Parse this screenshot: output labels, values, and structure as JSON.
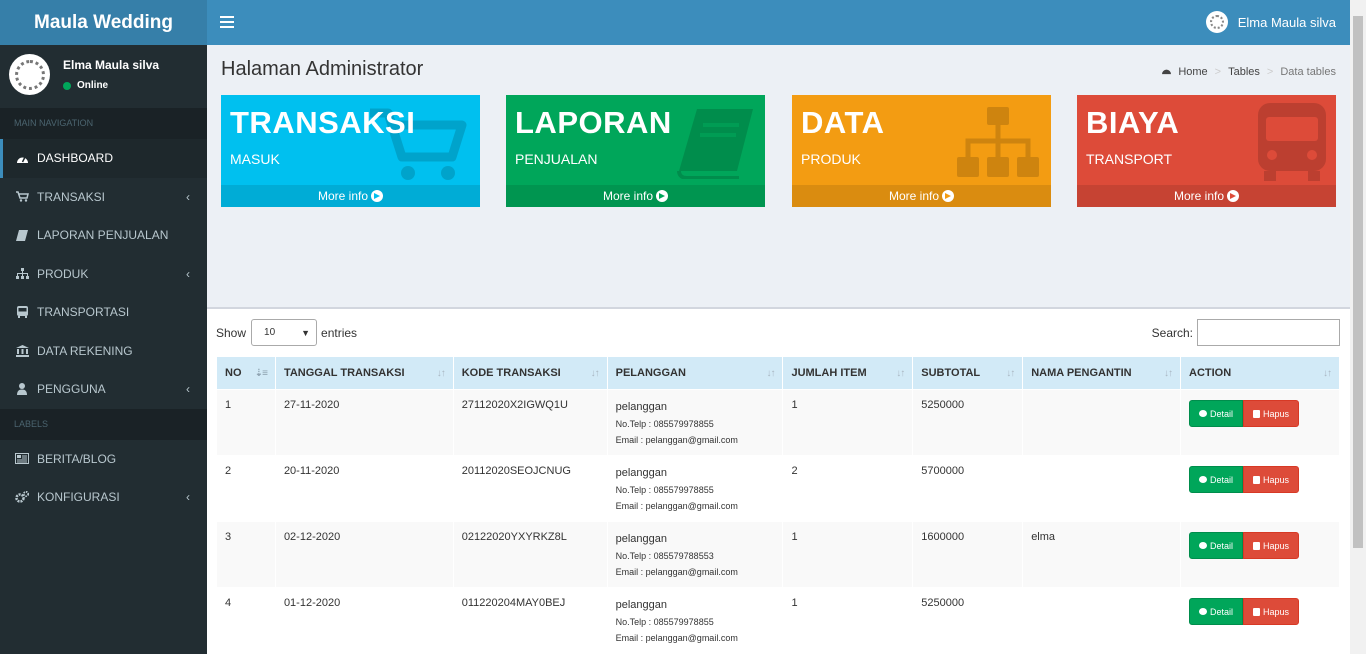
{
  "app": {
    "brand": "Maula Wedding",
    "user_name": "Elma Maula silva"
  },
  "sidebar": {
    "user": {
      "name": "Elma Maula silva",
      "status": "Online"
    },
    "main_nav_header": "MAIN NAVIGATION",
    "items": [
      {
        "label": "DASHBOARD",
        "icon": "dashboard-icon"
      },
      {
        "label": "TRANSAKSI",
        "icon": "cart-icon"
      },
      {
        "label": "LAPORAN PENJUALAN",
        "icon": "book-icon"
      },
      {
        "label": "PRODUK",
        "icon": "sitemap-icon"
      },
      {
        "label": "TRANSPORTASI",
        "icon": "bus-icon"
      },
      {
        "label": "DATA REKENING",
        "icon": "bank-icon"
      },
      {
        "label": "PENGGUNA",
        "icon": "user-icon"
      }
    ],
    "labels_header": "LABELS",
    "label_items": [
      {
        "label": "BERITA/BLOG",
        "icon": "newspaper-icon"
      },
      {
        "label": "KONFIGURASI",
        "icon": "cogs-icon"
      }
    ]
  },
  "page": {
    "title": "Halaman Administrator",
    "breadcrumb": [
      "Home",
      "Tables",
      "Data tables"
    ]
  },
  "boxes": [
    {
      "title": "TRANSAKSI",
      "subtitle": "MASUK",
      "footer": "More info",
      "color": "#00c0ef",
      "icon": "cart-icon"
    },
    {
      "title": "LAPORAN",
      "subtitle": "PENJUALAN",
      "footer": "More info",
      "color": "#00a65a",
      "icon": "book-icon"
    },
    {
      "title": "DATA",
      "subtitle": "PRODUK",
      "footer": "More info",
      "color": "#f39c12",
      "icon": "sitemap-icon"
    },
    {
      "title": "BIAYA",
      "subtitle": "TRANSPORT",
      "footer": "More info",
      "color": "#dd4b39",
      "icon": "bus-icon"
    }
  ],
  "table": {
    "show_label": "Show",
    "entries_value": "10",
    "entries_label": "entries",
    "search_label": "Search:",
    "headers": [
      "NO",
      "TANGGAL TRANSAKSI",
      "KODE TRANSAKSI",
      "PELANGGAN",
      "JUMLAH ITEM",
      "SUBTOTAL",
      "NAMA PENGANTIN",
      "ACTION"
    ],
    "detail_label": "Detail",
    "hapus_label": "Hapus",
    "rows": [
      {
        "no": "1",
        "tanggal": "27-11-2020",
        "kode": "27112020X2IGWQ1U",
        "pelanggan": "pelanggan",
        "telp": "No.Telp : 085579978855",
        "email": "Email : pelanggan@gmail.com",
        "jumlah": "1",
        "subtotal": "5250000",
        "pengantin": ""
      },
      {
        "no": "2",
        "tanggal": "20-11-2020",
        "kode": "20112020SEOJCNUG",
        "pelanggan": "pelanggan",
        "telp": "No.Telp : 085579978855",
        "email": "Email : pelanggan@gmail.com",
        "jumlah": "2",
        "subtotal": "5700000",
        "pengantin": ""
      },
      {
        "no": "3",
        "tanggal": "02-12-2020",
        "kode": "02122020YXYRKZ8L",
        "pelanggan": "pelanggan",
        "telp": "No.Telp : 085579788553",
        "email": "Email : pelanggan@gmail.com",
        "jumlah": "1",
        "subtotal": "1600000",
        "pengantin": "elma"
      },
      {
        "no": "4",
        "tanggal": "01-12-2020",
        "kode": "011220204MAY0BEJ",
        "pelanggan": "pelanggan",
        "telp": "No.Telp : 085579978855",
        "email": "Email : pelanggan@gmail.com",
        "jumlah": "1",
        "subtotal": "5250000",
        "pengantin": ""
      }
    ]
  }
}
